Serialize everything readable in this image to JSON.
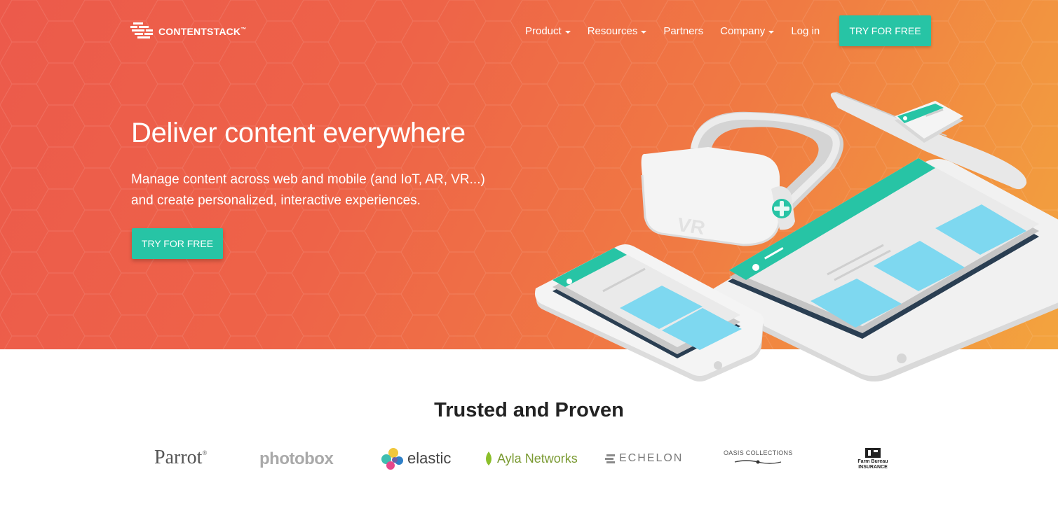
{
  "brand": {
    "name": "CONTENTSTACK",
    "tm": "™"
  },
  "nav": {
    "items": [
      {
        "label": "Product",
        "dropdown": true
      },
      {
        "label": "Resources",
        "dropdown": true
      },
      {
        "label": "Partners",
        "dropdown": false
      },
      {
        "label": "Company",
        "dropdown": true
      },
      {
        "label": "Log in",
        "dropdown": false
      }
    ],
    "cta": "TRY FOR FREE"
  },
  "hero": {
    "title": "Deliver content everywhere",
    "subtitle": "Manage content across web and mobile (and IoT, AR, VR...) and create personalized, interactive experiences.",
    "cta": "TRY FOR FREE",
    "vr_label": "VR"
  },
  "trusted": {
    "title": "Trusted and Proven",
    "logos": [
      {
        "name": "Parrot",
        "mark": "®"
      },
      {
        "name": "photobox"
      },
      {
        "name": "elastic"
      },
      {
        "name": "Ayla Networks"
      },
      {
        "name": "ECHELON"
      },
      {
        "name": "OASIS COLLECTIONS"
      },
      {
        "name": "Farm Bureau INSURANCE"
      }
    ]
  },
  "colors": {
    "accent": "#27c4a5",
    "hero_start": "#ec5a4b",
    "hero_end": "#f3a43e",
    "screen_blue": "#7ed8f0"
  }
}
